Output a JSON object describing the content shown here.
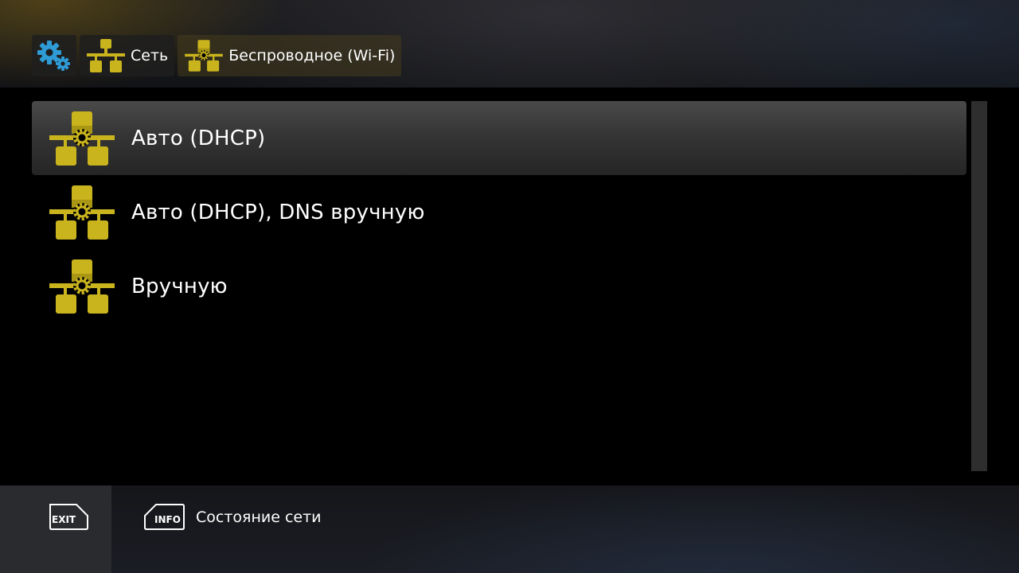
{
  "breadcrumb": {
    "items": [
      {
        "icon": "settings-gears-icon"
      },
      {
        "icon": "network-icon",
        "label": "Сеть"
      },
      {
        "icon": "network-settings-icon",
        "label": "Беспроводное (Wi-Fi)"
      }
    ]
  },
  "menu": {
    "items": [
      {
        "label": "Авто (DHCP)",
        "icon": "network-settings-icon",
        "selected": true
      },
      {
        "label": "Авто (DHCP), DNS вручную",
        "icon": "network-settings-icon",
        "selected": false
      },
      {
        "label": "Вручную",
        "icon": "network-settings-icon",
        "selected": false
      }
    ]
  },
  "footer": {
    "exit_key": "EXIT",
    "info_key": "INFO",
    "info_label": "Состояние сети"
  },
  "colors": {
    "icon_gold": "#c9b41e",
    "gear_blue": "#2f9bd6"
  }
}
